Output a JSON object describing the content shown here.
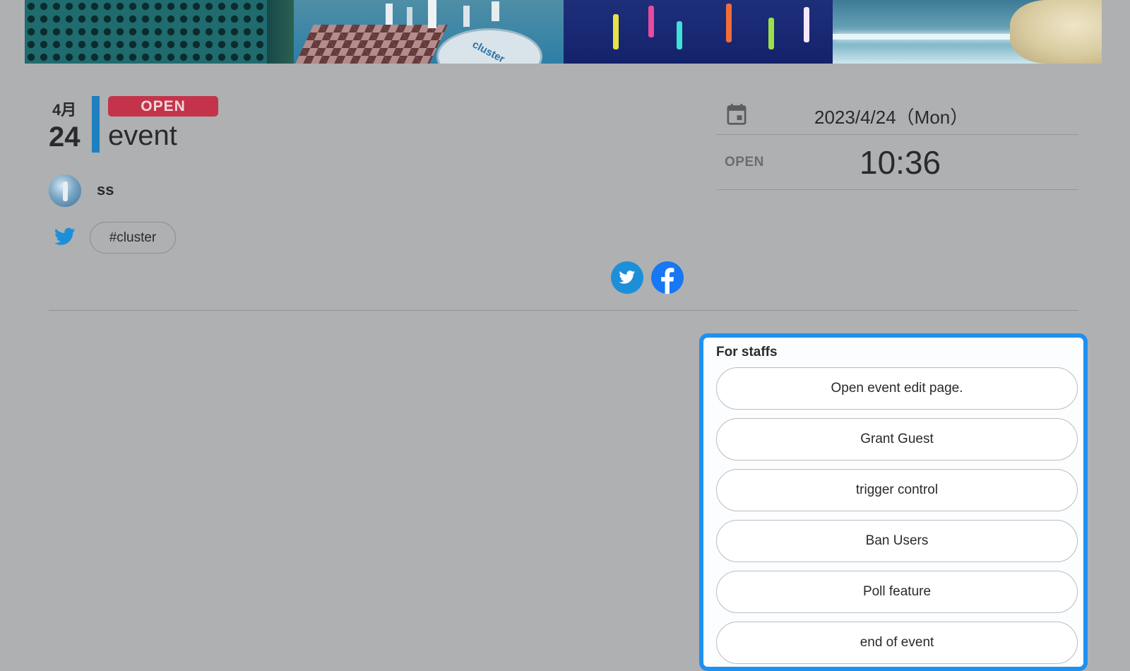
{
  "banner": {
    "disc_logo_text": "cluster"
  },
  "event": {
    "month": "4月",
    "day": "24",
    "status": "OPEN",
    "title": "event",
    "organizer": "ss",
    "hashtag": "#cluster"
  },
  "schedule": {
    "date": "2023/4/24（Mon）",
    "open_label": "OPEN",
    "open_time": "10:36"
  },
  "staff_panel": {
    "title": "For staffs",
    "buttons": [
      "Open event edit page.",
      "Grant Guest",
      "trigger control",
      "Ban Users",
      "Poll feature",
      "end of event"
    ]
  },
  "colors": {
    "badge": "#c3344a",
    "accent_bar": "#1f7fbf",
    "panel_border": "#1e90ef",
    "twitter": "#1d8fd8",
    "facebook": "#1877f2"
  }
}
